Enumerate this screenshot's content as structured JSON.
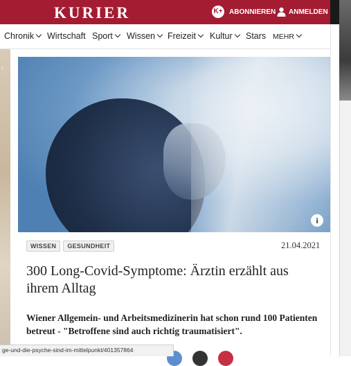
{
  "header": {
    "logo": "KURIER",
    "kplus_label": "K+",
    "subscribe_label": "ABONNIEREN",
    "login_label": "ANMELDEN",
    "brand_color": "#a31c32"
  },
  "nav": {
    "items": [
      {
        "label": "Chronik",
        "has_dropdown": true
      },
      {
        "label": "Wirtschaft",
        "has_dropdown": false
      },
      {
        "label": "Sport",
        "has_dropdown": true
      },
      {
        "label": "Wissen",
        "has_dropdown": true
      },
      {
        "label": "Freizeit",
        "has_dropdown": true
      },
      {
        "label": "Kultur",
        "has_dropdown": true
      },
      {
        "label": "Stars",
        "has_dropdown": false
      },
      {
        "label": "MEHR",
        "has_dropdown": true
      }
    ]
  },
  "article": {
    "info_icon": "i",
    "tags": [
      "WISSEN",
      "GESUNDHEIT"
    ],
    "date": "21.04.2021",
    "headline": "300 Long-Covid-Symptome: Ärztin erzählt aus ihrem Alltag",
    "lead": "Wiener Allgemein- und Arbeitsmedizinerin hat schon rund 100 Patienten betreut - \"Betroffene sind auch richtig traumatisiert\"."
  },
  "share": {
    "colors": [
      "#5b8fd0",
      "#333333",
      "#c63045"
    ]
  },
  "statusbar": {
    "url": "ge-und-die-psyche-sind-im-mittelpunkt/401357864"
  }
}
